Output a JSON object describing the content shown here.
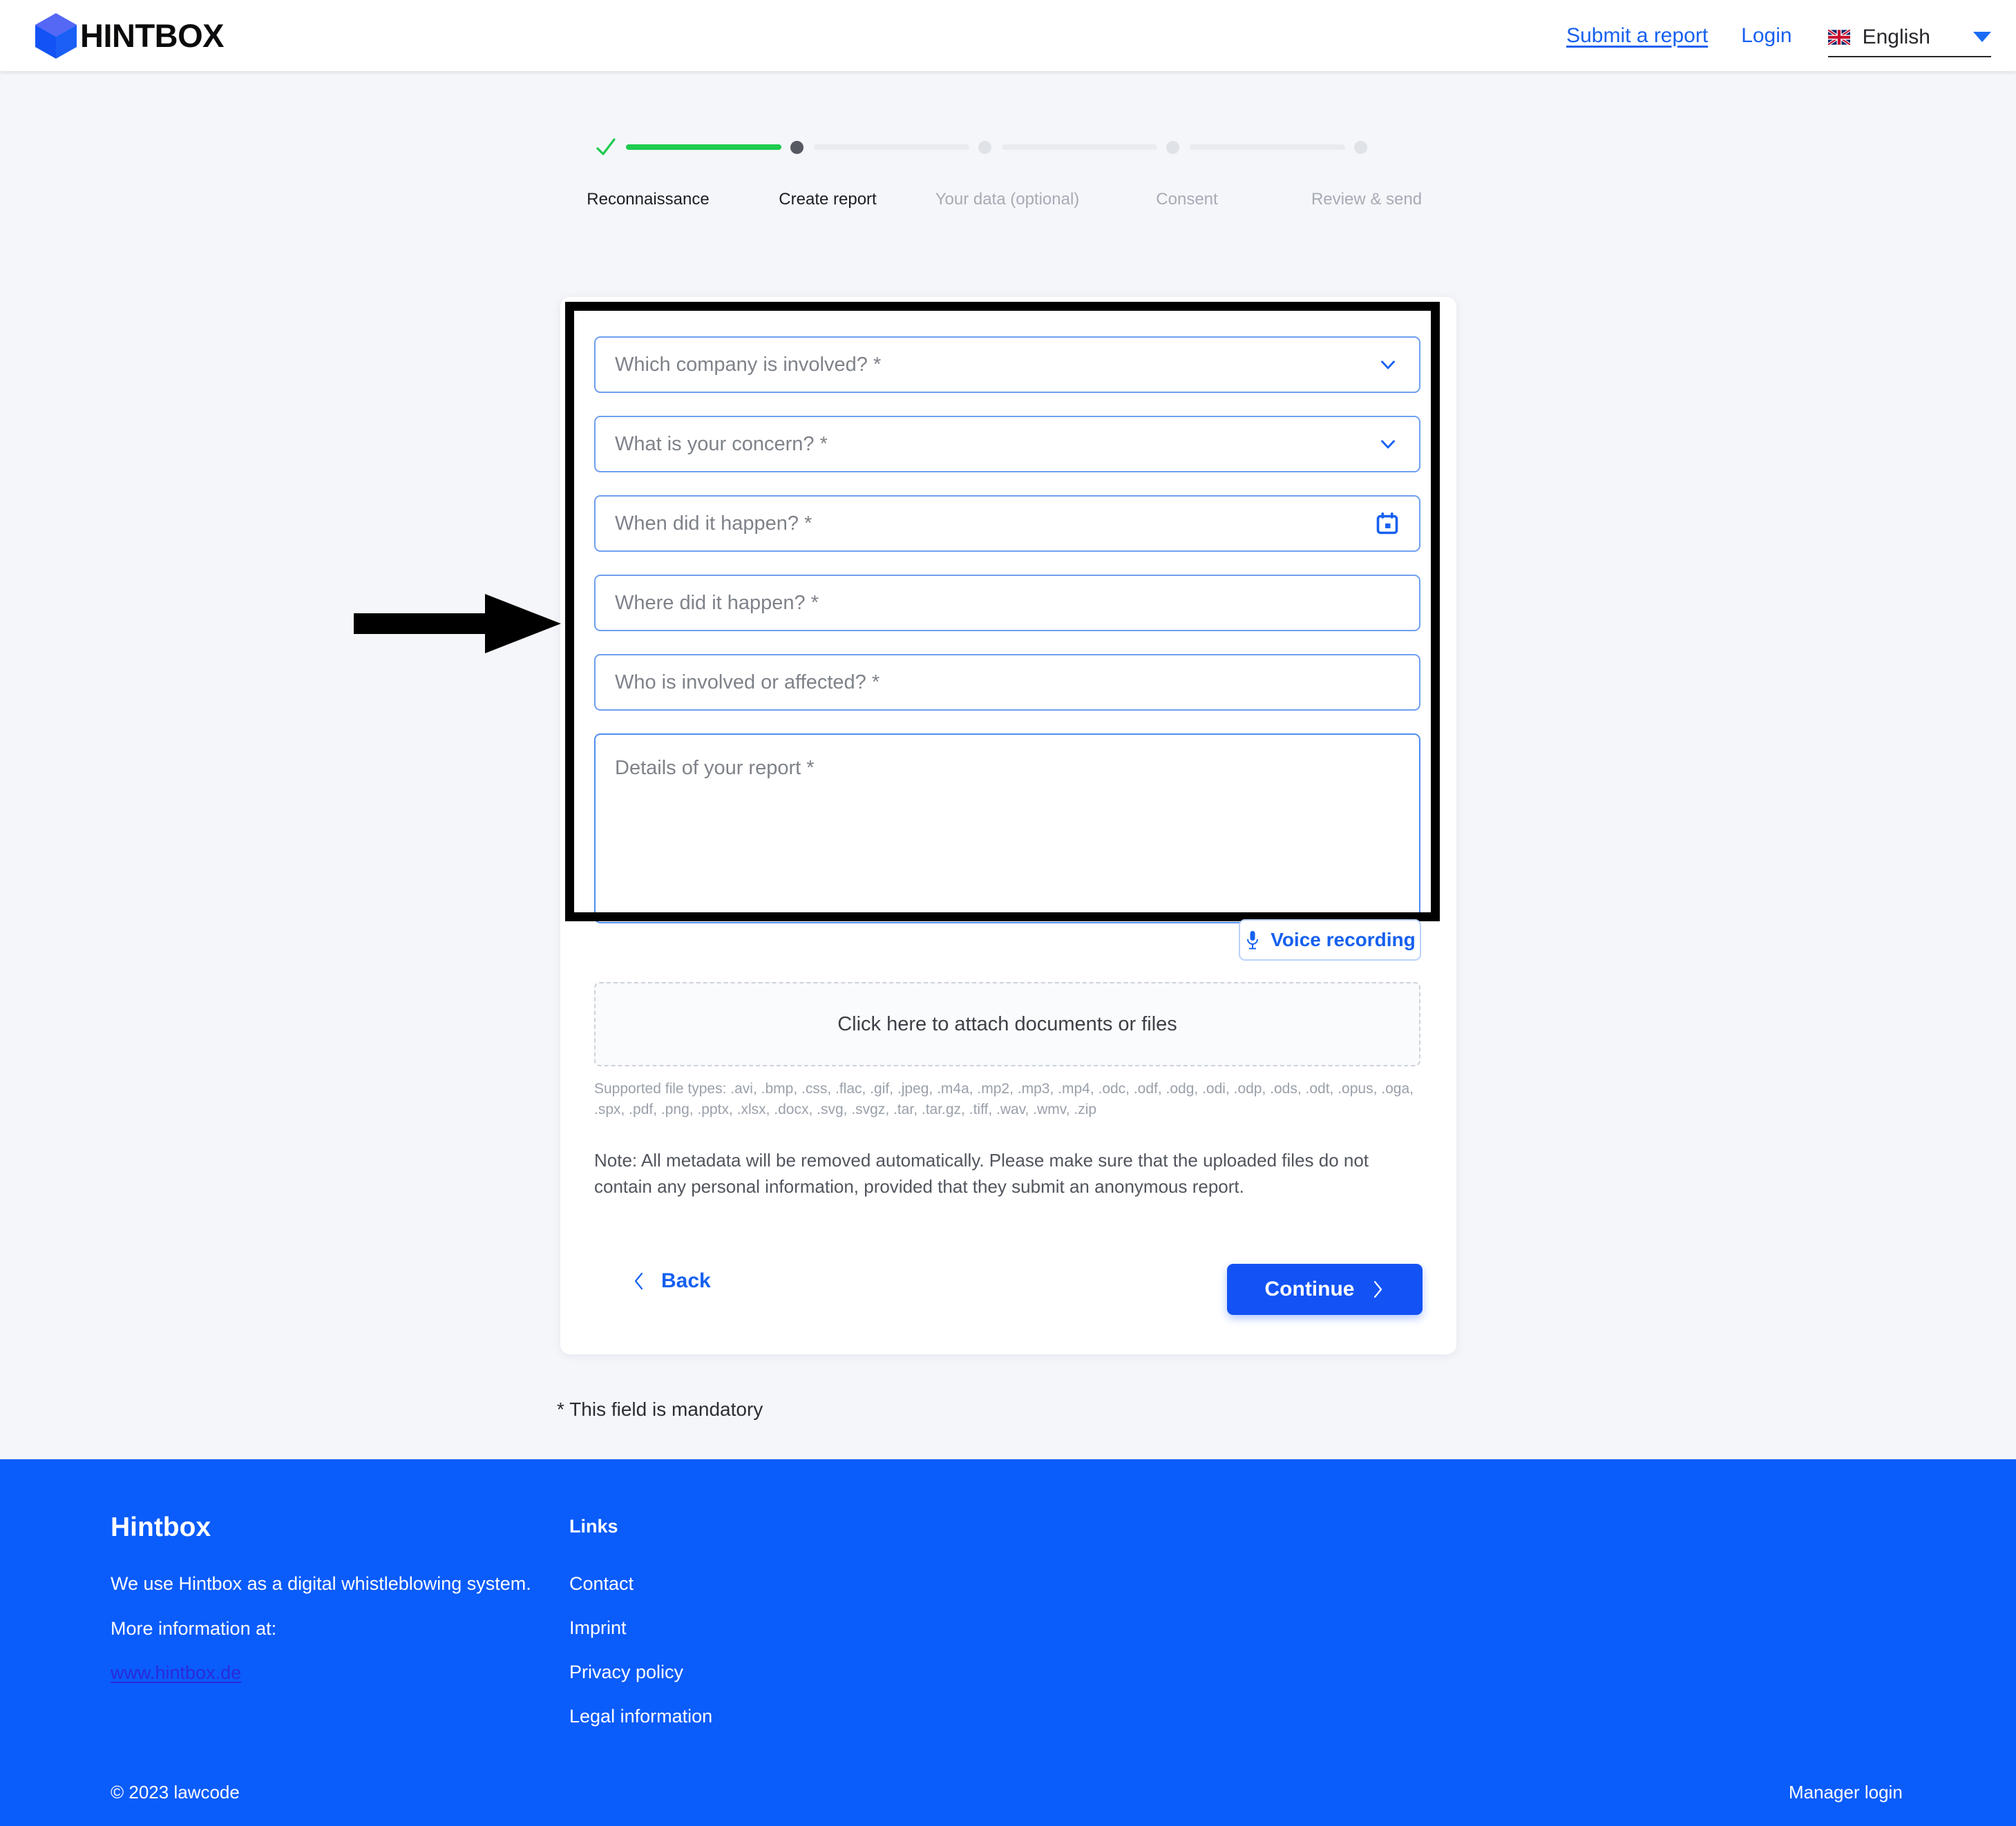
{
  "header": {
    "logo_text": "HINTBOX",
    "logo_icon": "cube-icon",
    "submit_report_label": "Submit a report",
    "login_label": "Login",
    "language": {
      "flag_icon": "uk-flag-icon",
      "label": "English",
      "caret_icon": "chevron-down-icon"
    }
  },
  "stepper": {
    "steps": [
      {
        "label": "Reconnaissance",
        "state": "done"
      },
      {
        "label": "Create report",
        "state": "current"
      },
      {
        "label": "Your data (optional)",
        "state": "pending"
      },
      {
        "label": "Consent",
        "state": "pending"
      },
      {
        "label": "Review & send",
        "state": "pending"
      }
    ],
    "check_icon": "check-icon"
  },
  "form": {
    "fields": [
      {
        "placeholder": "Which company is involved? *",
        "type": "select",
        "icon": "chevron-down-icon",
        "value": ""
      },
      {
        "placeholder": "What is your concern? *",
        "type": "select",
        "icon": "chevron-down-icon",
        "value": ""
      },
      {
        "placeholder": "When did it happen? *",
        "type": "date",
        "icon": "calendar-icon",
        "value": ""
      },
      {
        "placeholder": "Where did it happen? *",
        "type": "text",
        "icon": "",
        "value": ""
      },
      {
        "placeholder": "Who is involved or affected? *",
        "type": "text",
        "icon": "",
        "value": ""
      }
    ],
    "details": {
      "placeholder": "Details of your report *",
      "value": ""
    },
    "voice_recording_label": "Voice recording",
    "voice_icon": "microphone-icon",
    "dropzone_label": "Click here to attach documents or files",
    "supported_types": "Supported file types: .avi, .bmp, .css, .flac, .gif, .jpeg, .m4a, .mp2, .mp3, .mp4, .odc, .odf, .odg, .odi, .odp, .ods, .odt, .opus, .oga, .spx, .pdf, .png, .pptx, .xlsx, .docx, .svg, .svgz, .tar, .tar.gz, .tiff, .wav, .wmv, .zip",
    "note": "Note: All metadata will be removed automatically. Please make sure that the uploaded files do not contain any personal information, provided that they submit an anonymous report.",
    "back_label": "Back",
    "back_icon": "chevron-left-icon",
    "continue_label": "Continue",
    "continue_icon": "chevron-right-icon",
    "mandatory_note": "* This field is mandatory"
  },
  "footer": {
    "brand_title": "Hintbox",
    "description": "We use Hintbox as a digital whistleblowing system.",
    "more_info_label": "More information at:",
    "url": "www.hintbox.de",
    "links_title": "Links",
    "links": [
      {
        "label": "Contact"
      },
      {
        "label": "Imprint"
      },
      {
        "label": "Privacy policy"
      },
      {
        "label": "Legal information"
      }
    ],
    "copyright": "© 2023 lawcode",
    "manager_login_label": "Manager login"
  },
  "annotations": {
    "highlight_box": "black-rectangle-highlight",
    "arrow": "black-arrow-pointing-right"
  },
  "colors": {
    "accent_blue": "#1353f5",
    "footer_blue": "#0a5cfb",
    "step_done_green": "#1fcb4f",
    "page_background": "#f4f6fa",
    "field_border": "#6f9ff0"
  }
}
